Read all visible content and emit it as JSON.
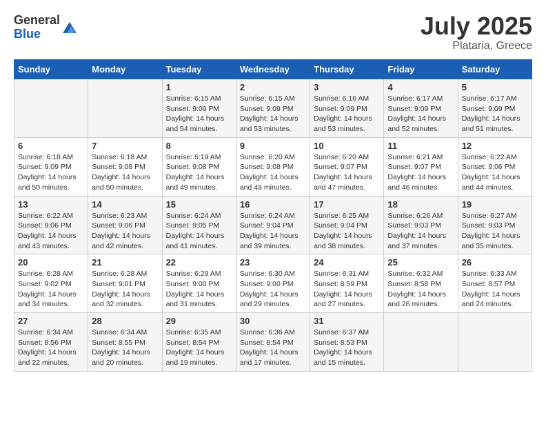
{
  "logo": {
    "general": "General",
    "blue": "Blue"
  },
  "header": {
    "month_year": "July 2025",
    "location": "Plataria, Greece"
  },
  "days_of_week": [
    "Sunday",
    "Monday",
    "Tuesday",
    "Wednesday",
    "Thursday",
    "Friday",
    "Saturday"
  ],
  "weeks": [
    [
      {
        "day": "",
        "info": ""
      },
      {
        "day": "",
        "info": ""
      },
      {
        "day": "1",
        "info": "Sunrise: 6:15 AM\nSunset: 9:09 PM\nDaylight: 14 hours and 54 minutes."
      },
      {
        "day": "2",
        "info": "Sunrise: 6:15 AM\nSunset: 9:09 PM\nDaylight: 14 hours and 53 minutes."
      },
      {
        "day": "3",
        "info": "Sunrise: 6:16 AM\nSunset: 9:09 PM\nDaylight: 14 hours and 53 minutes."
      },
      {
        "day": "4",
        "info": "Sunrise: 6:17 AM\nSunset: 9:09 PM\nDaylight: 14 hours and 52 minutes."
      },
      {
        "day": "5",
        "info": "Sunrise: 6:17 AM\nSunset: 9:09 PM\nDaylight: 14 hours and 51 minutes."
      }
    ],
    [
      {
        "day": "6",
        "info": "Sunrise: 6:18 AM\nSunset: 9:09 PM\nDaylight: 14 hours and 50 minutes."
      },
      {
        "day": "7",
        "info": "Sunrise: 6:18 AM\nSunset: 9:08 PM\nDaylight: 14 hours and 50 minutes."
      },
      {
        "day": "8",
        "info": "Sunrise: 6:19 AM\nSunset: 9:08 PM\nDaylight: 14 hours and 49 minutes."
      },
      {
        "day": "9",
        "info": "Sunrise: 6:20 AM\nSunset: 9:08 PM\nDaylight: 14 hours and 48 minutes."
      },
      {
        "day": "10",
        "info": "Sunrise: 6:20 AM\nSunset: 9:07 PM\nDaylight: 14 hours and 47 minutes."
      },
      {
        "day": "11",
        "info": "Sunrise: 6:21 AM\nSunset: 9:07 PM\nDaylight: 14 hours and 46 minutes."
      },
      {
        "day": "12",
        "info": "Sunrise: 6:22 AM\nSunset: 9:06 PM\nDaylight: 14 hours and 44 minutes."
      }
    ],
    [
      {
        "day": "13",
        "info": "Sunrise: 6:22 AM\nSunset: 9:06 PM\nDaylight: 14 hours and 43 minutes."
      },
      {
        "day": "14",
        "info": "Sunrise: 6:23 AM\nSunset: 9:06 PM\nDaylight: 14 hours and 42 minutes."
      },
      {
        "day": "15",
        "info": "Sunrise: 6:24 AM\nSunset: 9:05 PM\nDaylight: 14 hours and 41 minutes."
      },
      {
        "day": "16",
        "info": "Sunrise: 6:24 AM\nSunset: 9:04 PM\nDaylight: 14 hours and 39 minutes."
      },
      {
        "day": "17",
        "info": "Sunrise: 6:25 AM\nSunset: 9:04 PM\nDaylight: 14 hours and 38 minutes."
      },
      {
        "day": "18",
        "info": "Sunrise: 6:26 AM\nSunset: 9:03 PM\nDaylight: 14 hours and 37 minutes."
      },
      {
        "day": "19",
        "info": "Sunrise: 6:27 AM\nSunset: 9:03 PM\nDaylight: 14 hours and 35 minutes."
      }
    ],
    [
      {
        "day": "20",
        "info": "Sunrise: 6:28 AM\nSunset: 9:02 PM\nDaylight: 14 hours and 34 minutes."
      },
      {
        "day": "21",
        "info": "Sunrise: 6:28 AM\nSunset: 9:01 PM\nDaylight: 14 hours and 32 minutes."
      },
      {
        "day": "22",
        "info": "Sunrise: 6:29 AM\nSunset: 9:00 PM\nDaylight: 14 hours and 31 minutes."
      },
      {
        "day": "23",
        "info": "Sunrise: 6:30 AM\nSunset: 9:00 PM\nDaylight: 14 hours and 29 minutes."
      },
      {
        "day": "24",
        "info": "Sunrise: 6:31 AM\nSunset: 8:59 PM\nDaylight: 14 hours and 27 minutes."
      },
      {
        "day": "25",
        "info": "Sunrise: 6:32 AM\nSunset: 8:58 PM\nDaylight: 14 hours and 26 minutes."
      },
      {
        "day": "26",
        "info": "Sunrise: 6:33 AM\nSunset: 8:57 PM\nDaylight: 14 hours and 24 minutes."
      }
    ],
    [
      {
        "day": "27",
        "info": "Sunrise: 6:34 AM\nSunset: 8:56 PM\nDaylight: 14 hours and 22 minutes."
      },
      {
        "day": "28",
        "info": "Sunrise: 6:34 AM\nSunset: 8:55 PM\nDaylight: 14 hours and 20 minutes."
      },
      {
        "day": "29",
        "info": "Sunrise: 6:35 AM\nSunset: 8:54 PM\nDaylight: 14 hours and 19 minutes."
      },
      {
        "day": "30",
        "info": "Sunrise: 6:36 AM\nSunset: 8:54 PM\nDaylight: 14 hours and 17 minutes."
      },
      {
        "day": "31",
        "info": "Sunrise: 6:37 AM\nSunset: 8:53 PM\nDaylight: 14 hours and 15 minutes."
      },
      {
        "day": "",
        "info": ""
      },
      {
        "day": "",
        "info": ""
      }
    ]
  ]
}
